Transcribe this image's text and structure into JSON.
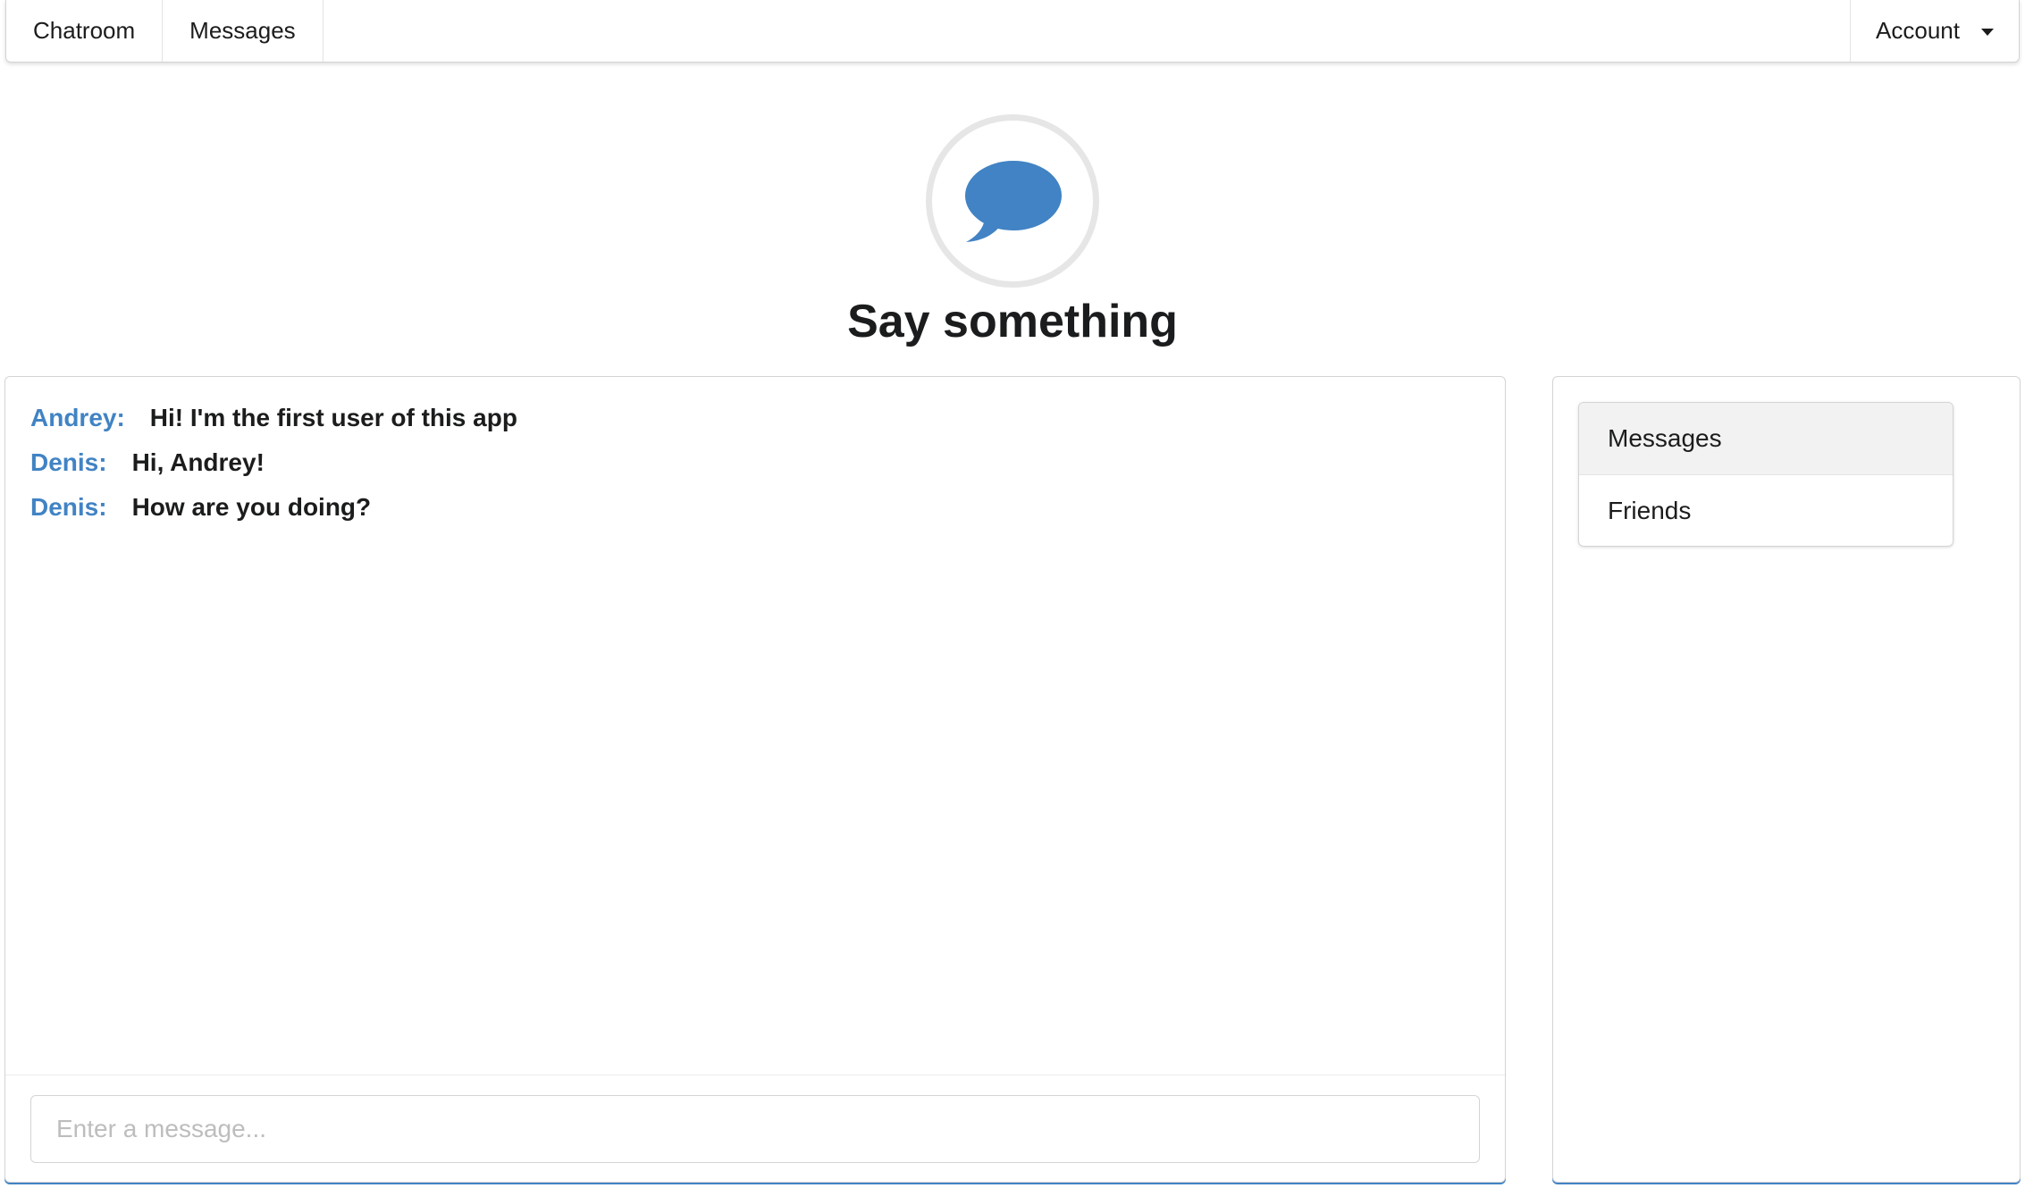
{
  "menu": {
    "items": [
      {
        "label": "Chatroom"
      },
      {
        "label": "Messages"
      }
    ],
    "account_label": "Account",
    "account_icon": "caret-down-icon"
  },
  "header": {
    "icon": "chat-bubble-icon",
    "icon_color": "#4183c4",
    "title": "Say something"
  },
  "chat": {
    "messages": [
      {
        "author": "Andrey:",
        "text": "Hi! I'm the first user of this app"
      },
      {
        "author": "Denis:",
        "text": "Hi, Andrey!"
      },
      {
        "author": "Denis:",
        "text": "How are you doing?"
      }
    ],
    "input": {
      "value": "",
      "placeholder": "Enter a message..."
    }
  },
  "sidebar": {
    "items": [
      {
        "label": "Messages",
        "active": true
      },
      {
        "label": "Friends",
        "active": false
      }
    ]
  },
  "colors": {
    "accent": "#4183c4",
    "text": "#1b1c1d",
    "border": "#d4d4d5"
  }
}
